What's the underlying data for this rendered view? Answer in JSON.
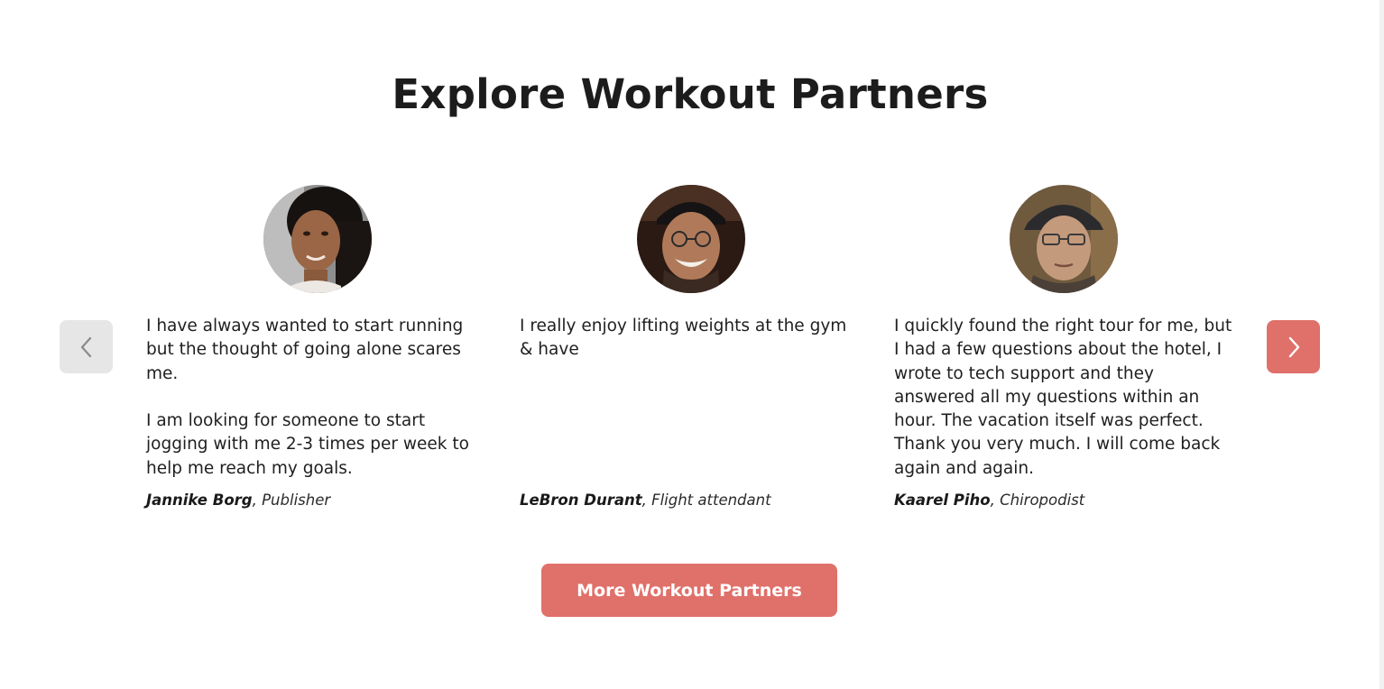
{
  "section": {
    "title": "Explore Workout Partners"
  },
  "carousel": {
    "prev_icon": "chevron-left-icon",
    "next_icon": "chevron-right-icon",
    "cards": [
      {
        "quote": "I have always wanted to start running but the thought of going alone scares me.\n\nI am looking for someone to start jogging with me 2-3 times per week to help me reach my goals.",
        "name": "Jannike Borg",
        "role": ", Publisher"
      },
      {
        "quote": "I really enjoy lifting weights at the gym & have",
        "name": "LeBron Durant",
        "role": ", Flight attendant"
      },
      {
        "quote": "I quickly found the right tour for me, but I had a few questions about the hotel, I wrote to tech support and they answered all my questions within an hour. The vacation itself was perfect. Thank you very much. I will come back again and again.",
        "name": "Kaarel Piho",
        "role": ", Chiropodist"
      }
    ]
  },
  "cta": {
    "label": "More Workout Partners"
  },
  "colors": {
    "accent": "#e0706a",
    "prev_button_bg": "#e6e6e6",
    "text": "#1f1f1f"
  }
}
